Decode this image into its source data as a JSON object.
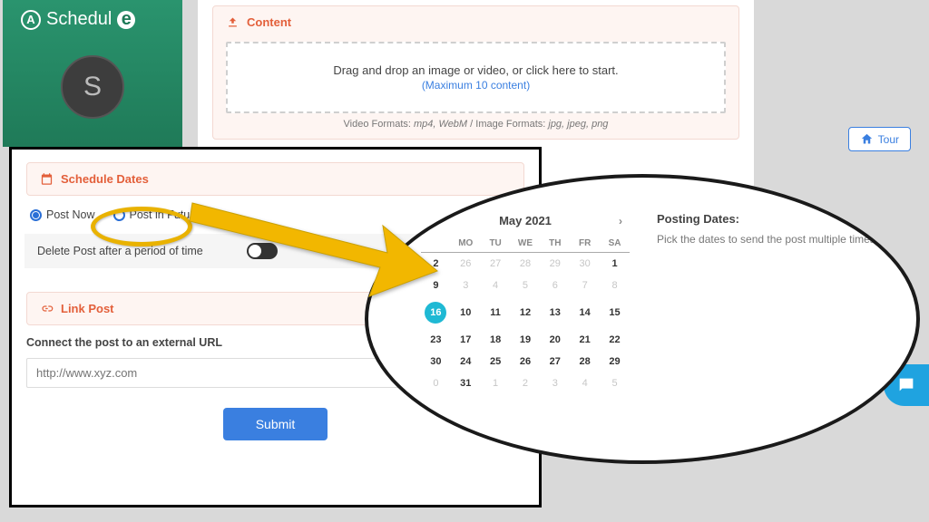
{
  "brand": {
    "name": "Schedul",
    "suffix": "e",
    "avatar_initial": "S"
  },
  "content_panel": {
    "title": "Content",
    "dropzone_text": "Drag and drop an image or video, or click here to start.",
    "dropzone_sub": "(Maximum 10 content)",
    "formats_video_label": "Video Formats:",
    "formats_video": "mp4, WebM",
    "formats_sep": "/",
    "formats_image_label": "Image Formats:",
    "formats_image": "jpg, jpeg, png"
  },
  "tour_label": "Tour",
  "schedule_panel": {
    "title": "Schedule Dates",
    "radio_now": "Post Now",
    "radio_future": "Post in Future",
    "delete_label": "Delete Post after a period of time"
  },
  "link_panel": {
    "title": "Link Post",
    "helper": "Connect the post to an external URL",
    "placeholder": "http://www.xyz.com"
  },
  "submit_label": "Submit",
  "calendar": {
    "month_label": "May 2021",
    "dow": [
      "MO",
      "TU",
      "WE",
      "TH",
      "FR",
      "SA"
    ],
    "rows": [
      [
        26,
        27,
        28,
        29,
        30,
        1
      ],
      [
        3,
        4,
        5,
        6,
        7,
        8
      ],
      [
        10,
        11,
        12,
        13,
        14,
        15
      ],
      [
        17,
        18,
        19,
        20,
        21,
        22
      ],
      [
        24,
        25,
        26,
        27,
        28,
        29
      ],
      [
        31,
        1,
        2,
        3,
        4,
        5
      ]
    ],
    "first_col": [
      2,
      9,
      16,
      23,
      30
    ],
    "dim_first_row_until": 5,
    "dim_last_row_from": 1,
    "today": 16
  },
  "posting": {
    "title": "Posting Dates:",
    "hint": "Pick the dates to send the post multiple times."
  }
}
